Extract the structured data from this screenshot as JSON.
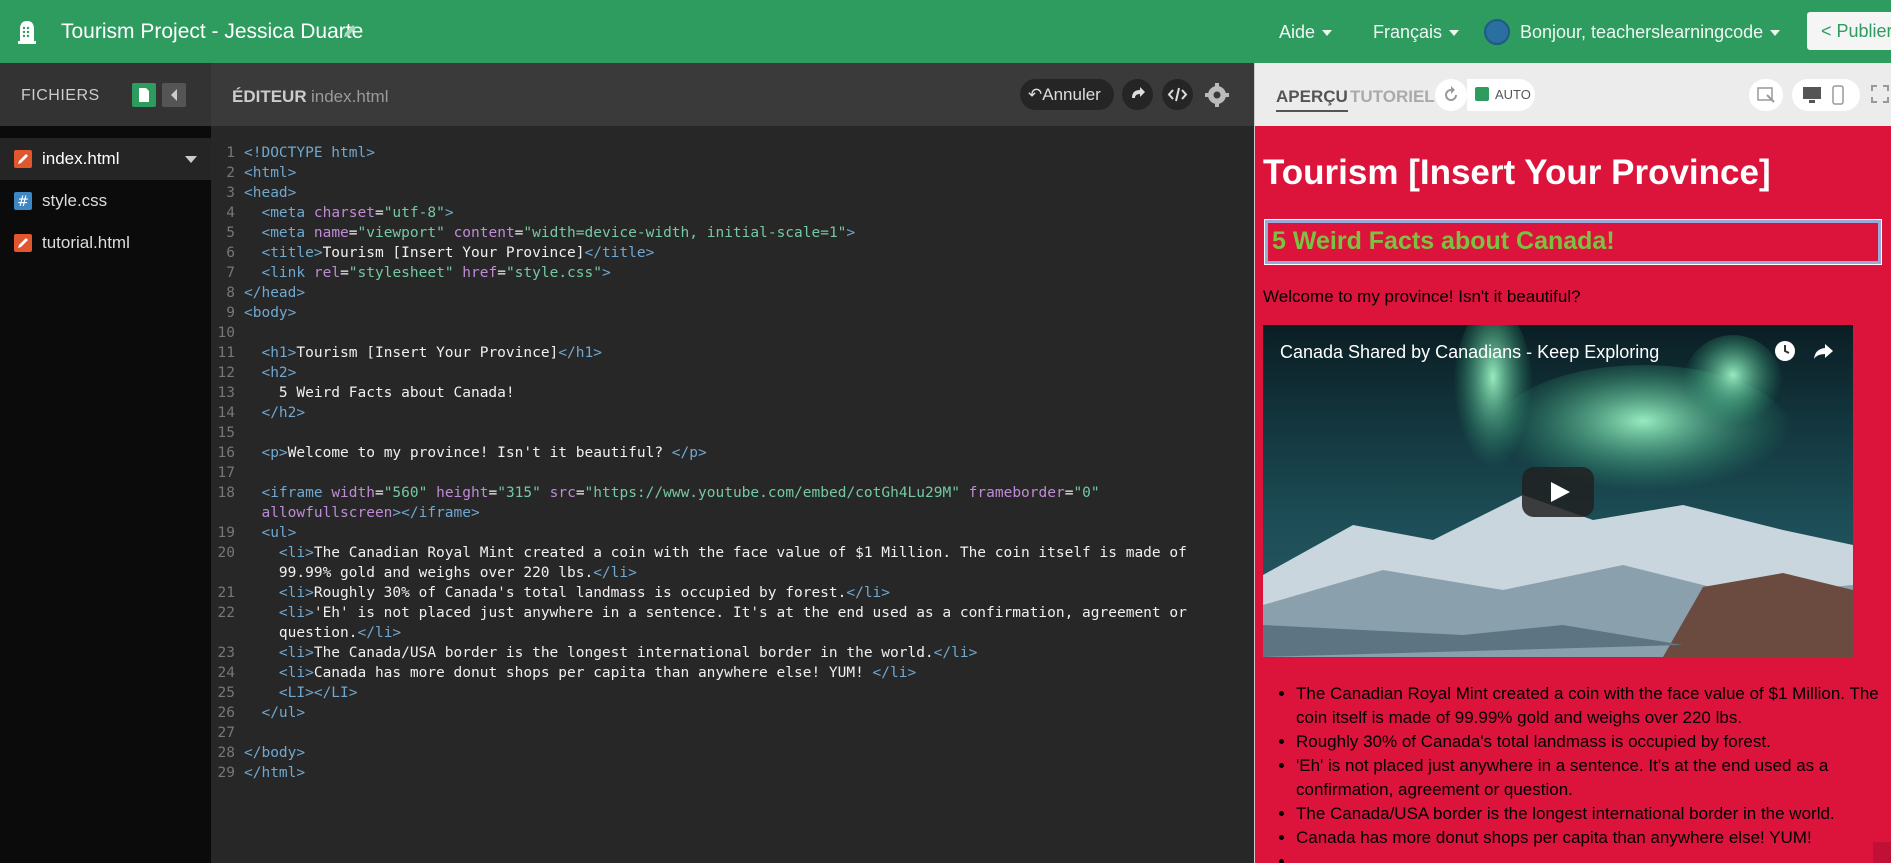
{
  "app": {
    "title": "Tourism Project - Jessica Duarte",
    "menu_help": "Aide",
    "menu_language": "Français",
    "user_greeting": "Bonjour, teacherslearningcode",
    "publish_label": "Publier",
    "brand_color": "#2e9b5f"
  },
  "sidebar": {
    "title": "FICHIERS",
    "files": [
      {
        "name": "index.html",
        "icon": "pencil-file-icon"
      },
      {
        "name": "style.css",
        "icon": "hash-file-icon"
      },
      {
        "name": "tutorial.html",
        "icon": "pencil-file-icon"
      }
    ]
  },
  "editor": {
    "title": "ÉDITEUR",
    "filename": "index.html",
    "undo_label": "Annuler"
  },
  "preview": {
    "tab_preview": "APERÇU",
    "tab_tutorial": "TUTORIEL",
    "auto_label": "AUTO",
    "background": "#dc143c",
    "h1": "Tourism [Insert Your Province]",
    "h2": "5 Weird Facts about Canada!",
    "paragraph": "Welcome to my province! Isn't it beautiful?",
    "video_title": "Canada Shared by Canadians - Keep Exploring",
    "list": [
      "The Canadian Royal Mint created a coin with the face value of $1 Million. The coin itself is made of 99.99% gold and weighs over 220 lbs.",
      "Roughly 30% of Canada's total landmass is occupied by forest.",
      "'Eh' is not placed just anywhere in a sentence. It's at the end used as a confirmation, agreement or question.",
      "The Canada/USA border is the longest international border in the world.",
      "Canada has more donut shops per capita than anywhere else! YUM!",
      ""
    ]
  },
  "code": {
    "lines": [
      {
        "n": "1",
        "segs": [
          [
            "tg",
            "<!DOCTYPE html>"
          ]
        ]
      },
      {
        "n": "2",
        "segs": [
          [
            "tg",
            "<html>"
          ]
        ]
      },
      {
        "n": "3",
        "segs": [
          [
            "tg",
            "<head>"
          ]
        ]
      },
      {
        "n": "4",
        "segs": [
          [
            "tx",
            "  "
          ],
          [
            "tg",
            "<meta "
          ],
          [
            "at",
            "charset"
          ],
          [
            "tx",
            "="
          ],
          [
            "st",
            "\"utf-8\""
          ],
          [
            "tg",
            ">"
          ]
        ]
      },
      {
        "n": "5",
        "segs": [
          [
            "tx",
            "  "
          ],
          [
            "tg",
            "<meta "
          ],
          [
            "at",
            "name"
          ],
          [
            "tx",
            "="
          ],
          [
            "st",
            "\"viewport\""
          ],
          [
            "tx",
            " "
          ],
          [
            "at",
            "content"
          ],
          [
            "tx",
            "="
          ],
          [
            "st",
            "\"width=device-width, initial-scale=1\""
          ],
          [
            "tg",
            ">"
          ]
        ]
      },
      {
        "n": "6",
        "segs": [
          [
            "tx",
            "  "
          ],
          [
            "tg",
            "<title>"
          ],
          [
            "tx",
            "Tourism [Insert Your Province]"
          ],
          [
            "tg",
            "</title>"
          ]
        ]
      },
      {
        "n": "7",
        "segs": [
          [
            "tx",
            "  "
          ],
          [
            "tg",
            "<link "
          ],
          [
            "at",
            "rel"
          ],
          [
            "tx",
            "="
          ],
          [
            "st",
            "\"stylesheet\""
          ],
          [
            "tx",
            " "
          ],
          [
            "at",
            "href"
          ],
          [
            "tx",
            "="
          ],
          [
            "st",
            "\"style.css\""
          ],
          [
            "tg",
            ">"
          ]
        ]
      },
      {
        "n": "8",
        "segs": [
          [
            "tg",
            "</head>"
          ]
        ]
      },
      {
        "n": "9",
        "segs": [
          [
            "tg",
            "<body>"
          ]
        ]
      },
      {
        "n": "10",
        "segs": []
      },
      {
        "n": "11",
        "segs": [
          [
            "tx",
            "  "
          ],
          [
            "tg",
            "<h1>"
          ],
          [
            "tx",
            "Tourism [Insert Your Province]"
          ],
          [
            "tg",
            "</h1>"
          ]
        ]
      },
      {
        "n": "12",
        "segs": [
          [
            "tx",
            "  "
          ],
          [
            "tg",
            "<h2>"
          ]
        ]
      },
      {
        "n": "13",
        "segs": [
          [
            "tx",
            "    5 Weird Facts about Canada!"
          ]
        ]
      },
      {
        "n": "14",
        "segs": [
          [
            "tx",
            "  "
          ],
          [
            "tg",
            "</h2>"
          ]
        ]
      },
      {
        "n": "15",
        "segs": []
      },
      {
        "n": "16",
        "segs": [
          [
            "tx",
            "  "
          ],
          [
            "tg",
            "<p>"
          ],
          [
            "tx",
            "Welcome to my province! Isn't it beautiful? "
          ],
          [
            "tg",
            "</p>"
          ]
        ]
      },
      {
        "n": "17",
        "segs": []
      },
      {
        "n": "18",
        "segs": [
          [
            "tx",
            "  "
          ],
          [
            "tg",
            "<iframe "
          ],
          [
            "at",
            "width"
          ],
          [
            "tx",
            "="
          ],
          [
            "st",
            "\"560\""
          ],
          [
            "tx",
            " "
          ],
          [
            "at",
            "height"
          ],
          [
            "tx",
            "="
          ],
          [
            "st",
            "\"315\""
          ],
          [
            "tx",
            " "
          ],
          [
            "at",
            "src"
          ],
          [
            "tx",
            "="
          ],
          [
            "st",
            "\"https://www.youtube.com/embed/cotGh4Lu29M\""
          ],
          [
            "tx",
            " "
          ],
          [
            "at",
            "frameborder"
          ],
          [
            "tx",
            "="
          ],
          [
            "st",
            "\"0\""
          ]
        ]
      },
      {
        "n": "",
        "segs": [
          [
            "tx",
            "  "
          ],
          [
            "at",
            "allowfullscreen"
          ],
          [
            "tg",
            "></iframe>"
          ]
        ]
      },
      {
        "n": "19",
        "segs": [
          [
            "tx",
            "  "
          ],
          [
            "tg",
            "<ul>"
          ]
        ]
      },
      {
        "n": "20",
        "segs": [
          [
            "tx",
            "    "
          ],
          [
            "tg",
            "<li>"
          ],
          [
            "tx",
            "The Canadian Royal Mint created a coin with the face value of $1 Million. The coin itself is made of"
          ]
        ]
      },
      {
        "n": "",
        "segs": [
          [
            "tx",
            "    99.99% gold and weighs over 220 lbs."
          ],
          [
            "tg",
            "</li>"
          ]
        ]
      },
      {
        "n": "21",
        "segs": [
          [
            "tx",
            "    "
          ],
          [
            "tg",
            "<li>"
          ],
          [
            "tx",
            "Roughly 30% of Canada's total landmass is occupied by forest."
          ],
          [
            "tg",
            "</li>"
          ]
        ]
      },
      {
        "n": "22",
        "segs": [
          [
            "tx",
            "    "
          ],
          [
            "tg",
            "<li>"
          ],
          [
            "tx",
            "'Eh' is not placed just anywhere in a sentence. It's at the end used as a confirmation, agreement or"
          ]
        ]
      },
      {
        "n": "",
        "segs": [
          [
            "tx",
            "    question."
          ],
          [
            "tg",
            "</li>"
          ]
        ]
      },
      {
        "n": "23",
        "segs": [
          [
            "tx",
            "    "
          ],
          [
            "tg",
            "<li>"
          ],
          [
            "tx",
            "The Canada/USA border is the longest international border in the world."
          ],
          [
            "tg",
            "</li>"
          ]
        ]
      },
      {
        "n": "24",
        "segs": [
          [
            "tx",
            "    "
          ],
          [
            "tg",
            "<li>"
          ],
          [
            "tx",
            "Canada has more donut shops per capita than anywhere else! YUM! "
          ],
          [
            "tg",
            "</li>"
          ]
        ]
      },
      {
        "n": "25",
        "segs": [
          [
            "tx",
            "    "
          ],
          [
            "tg",
            "<LI></LI>"
          ]
        ]
      },
      {
        "n": "26",
        "segs": [
          [
            "tx",
            "  "
          ],
          [
            "tg",
            "</ul>"
          ]
        ]
      },
      {
        "n": "27",
        "segs": []
      },
      {
        "n": "28",
        "segs": [
          [
            "tg",
            "</body>"
          ]
        ]
      },
      {
        "n": "29",
        "segs": [
          [
            "tg",
            "</html>"
          ]
        ]
      }
    ]
  }
}
